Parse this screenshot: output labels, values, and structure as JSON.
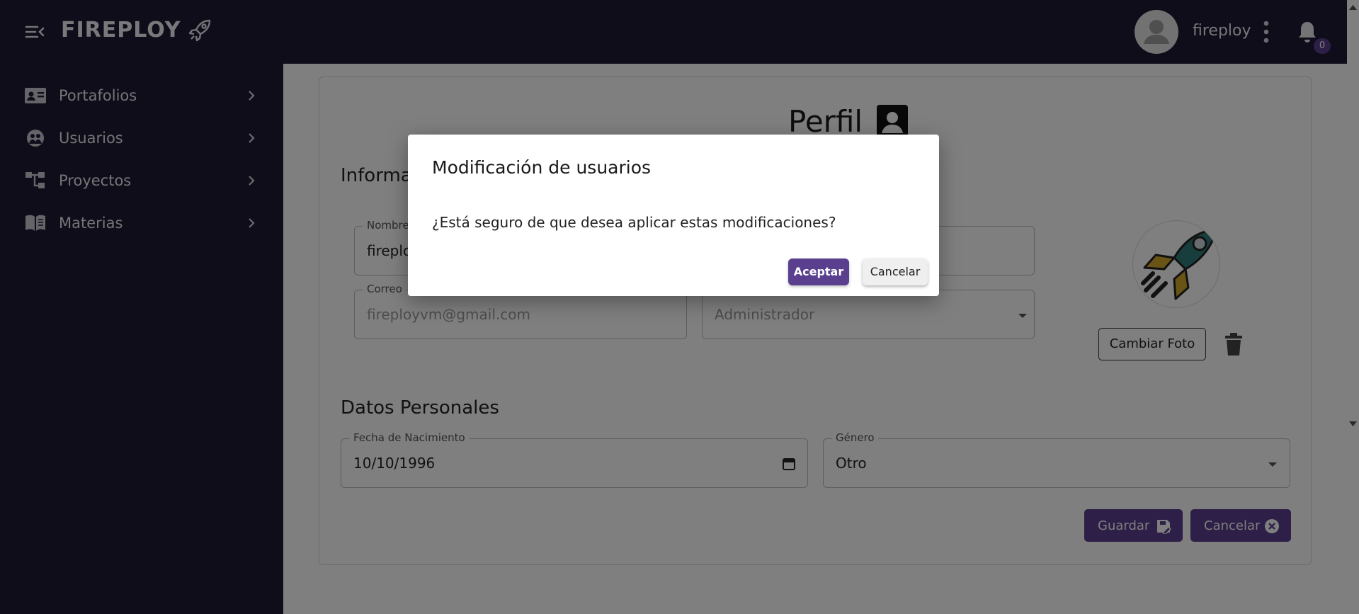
{
  "header": {
    "brand": "FIREPLOY",
    "username": "fireploy",
    "notification_count": "0"
  },
  "sidebar": {
    "items": [
      {
        "label": "Portafolios",
        "icon": "id-card-icon"
      },
      {
        "label": "Usuarios",
        "icon": "users-icon"
      },
      {
        "label": "Proyectos",
        "icon": "hierarchy-icon"
      },
      {
        "label": "Materias",
        "icon": "book-icon"
      }
    ]
  },
  "profile": {
    "title": "Perfil",
    "section_info": "Informa",
    "fields": {
      "name_label": "Nombre",
      "name_value": "fireplo",
      "email_label": "Correo",
      "email_value": "fireployvm@gmail.com",
      "role_value": "Administrador"
    },
    "change_photo": "Cambiar Foto",
    "section_personal": "Datos Personales",
    "birth_label": "Fecha de Nacimiento",
    "birth_value": "10/10/1996",
    "gender_label": "Género",
    "gender_value": "Otro",
    "save_label": "Guardar",
    "cancel_label": "Cancelar"
  },
  "dialog": {
    "title": "Modificación de usuarios",
    "message": "¿Está seguro de que desea aplicar estas modificaciones?",
    "accept": "Aceptar",
    "cancel": "Cancelar"
  },
  "colors": {
    "nav_bg": "#1c1b33",
    "primary": "#5a3f8f"
  }
}
